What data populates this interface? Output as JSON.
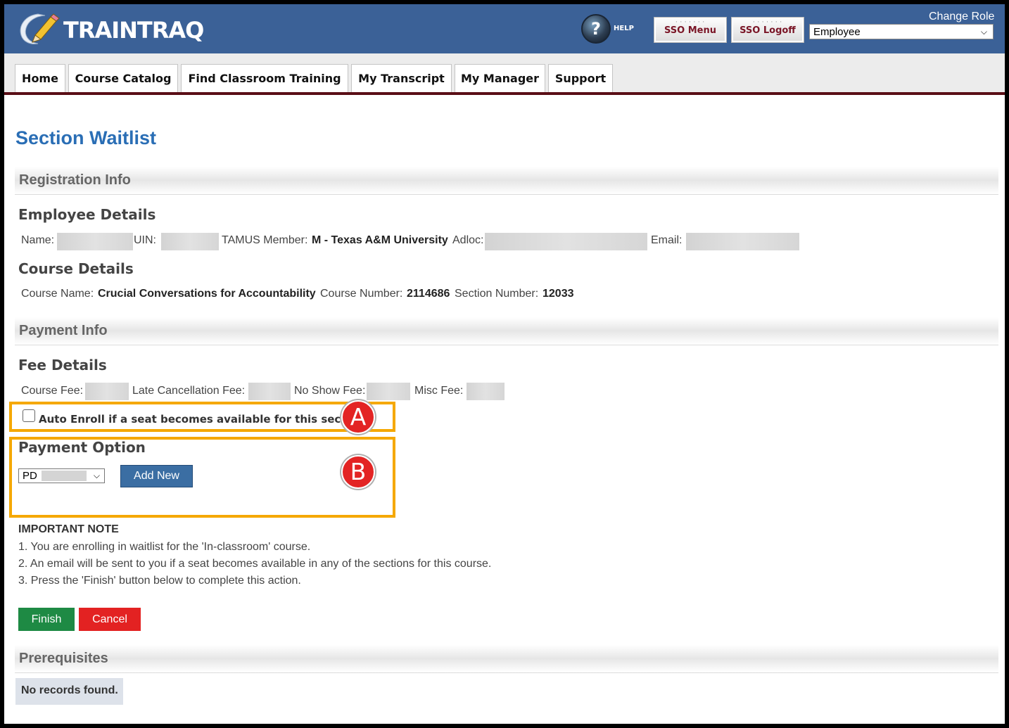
{
  "header": {
    "logo_text": "TRAINTRAQ",
    "help_label": "HELP",
    "help_glyph": "?",
    "sso_menu_label": "SSO Menu",
    "sso_logoff_label": "SSO Logoff",
    "change_role_label": "Change Role",
    "role_selected": "Employee"
  },
  "nav": {
    "tabs": [
      {
        "label": "Home"
      },
      {
        "label": "Course Catalog"
      },
      {
        "label": "Find Classroom Training"
      },
      {
        "label": "My Transcript"
      },
      {
        "label": "My Manager"
      },
      {
        "label": "Support"
      }
    ]
  },
  "page_title": "Section Waitlist",
  "registration_info": {
    "heading": "Registration Info",
    "employee_details_heading": "Employee Details",
    "name_label": "Name:",
    "uin_label": "UIN:",
    "member_label": "TAMUS Member:",
    "member_value": "M - Texas A&M University",
    "adloc_label": "Adloc:",
    "email_label": "Email:",
    "course_details_heading": "Course Details",
    "course_name_label": "Course Name:",
    "course_name_value": "Crucial Conversations for Accountability",
    "course_number_label": "Course Number:",
    "course_number_value": "2114686",
    "section_number_label": "Section Number:",
    "section_number_value": "12033"
  },
  "payment_info": {
    "heading": "Payment Info",
    "fee_details_heading": "Fee Details",
    "course_fee_label": "Course Fee:",
    "late_cancel_label": "Late Cancellation Fee:",
    "no_show_label": "No Show Fee:",
    "misc_fee_label": "Misc Fee:",
    "auto_enroll_label": "Auto Enroll if a seat becomes available for this section",
    "auto_enroll_checked": false,
    "payment_option_heading": "Payment Option",
    "payment_selected": "PD",
    "add_new_label": "Add New"
  },
  "annotations": {
    "badge_a": "A",
    "badge_b": "B",
    "highlight_color": "#f5a800",
    "badge_color": "#e32424"
  },
  "important_note": {
    "title": "IMPORTANT NOTE",
    "lines": [
      "1. You are enrolling in waitlist for the 'In-classroom' course.",
      "2. An email will be sent to you if a seat becomes available in any of the sections for this course.",
      "3. Press the 'Finish' button below to complete this action."
    ]
  },
  "actions": {
    "finish_label": "Finish",
    "cancel_label": "Cancel"
  },
  "prerequisites": {
    "heading": "Prerequisites",
    "empty_message": "No records found."
  },
  "colors": {
    "header_bg": "#3b6197",
    "nav_accent": "#5a0e16",
    "title_blue": "#2a6eb5",
    "finish_green": "#1e8a44",
    "cancel_red": "#e32222",
    "add_new_blue": "#3b6ea3"
  }
}
